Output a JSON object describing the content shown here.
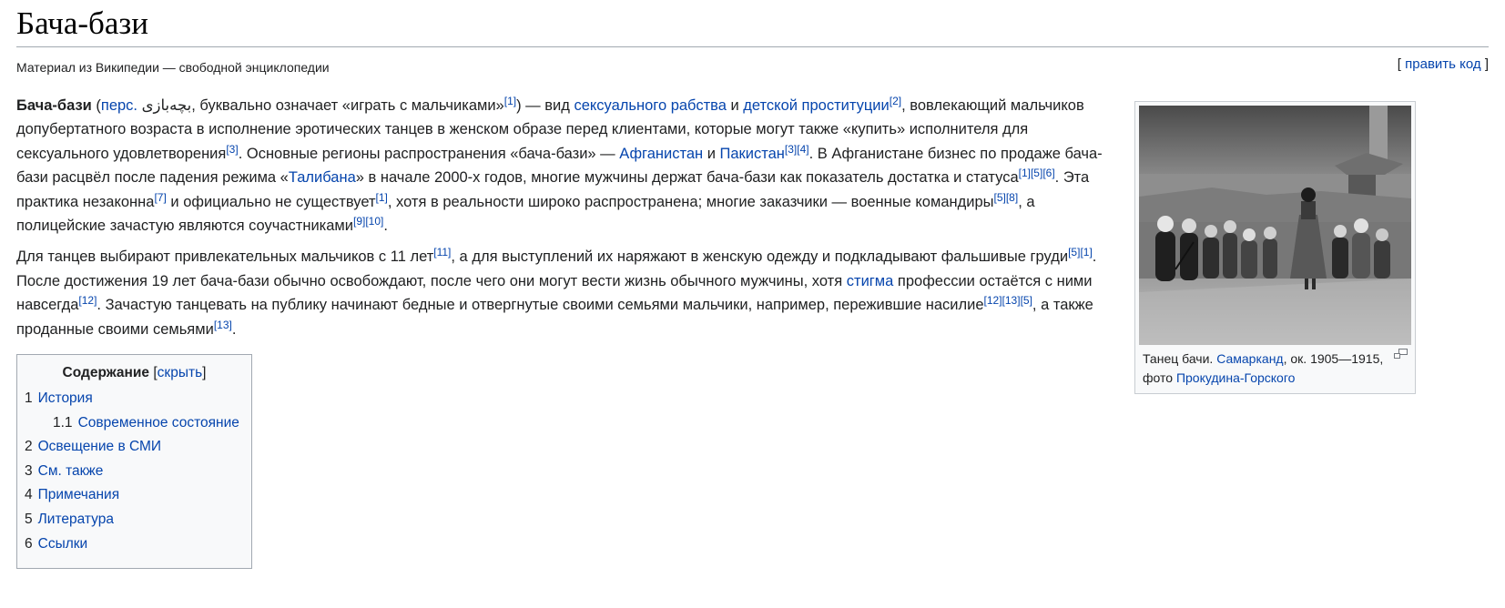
{
  "page": {
    "title": "Бача-бази",
    "tagline": "Материал из Википедии — свободной энциклопедии",
    "edit": {
      "open": "[ ",
      "label": "править код",
      "close": " ]"
    }
  },
  "paragraph1": {
    "term": "Бача-бази",
    "lang_link": "перс.",
    "persian": "بچه‌بازی",
    "t1": ", буквально означает «играть с мальчиками»",
    "r1": "[1]",
    "t2": " — вид ",
    "l1": "сексуального рабства",
    "t3": " и ",
    "l2": "детской проституции",
    "r2": "[2]",
    "t4": ", вовлекающий мальчиков допубертатного возраста в исполнение эротических танцев в женском образе перед клиентами, которые могут также «купить» исполнителя для сексуального удовлетворения",
    "r3": "[3]",
    "t5": ". Основные регионы распространения «бача-бази» — ",
    "l3": "Афганистан",
    "t6": " и ",
    "l4": "Пакистан",
    "r4": "[3]",
    "r5": "[4]",
    "t7": ". В Афганистане бизнес по продаже бача-бази расцвёл после падения режима «",
    "l5": "Талибана",
    "t8": "» в начале 2000-х годов, многие мужчины держат бача-бази как показатель достатка и статуса",
    "r6": "[1]",
    "r7": "[5]",
    "r8": "[6]",
    "t9": ". Эта практика незаконна",
    "r9": "[7]",
    "t10": " и официально не существует",
    "r10": "[1]",
    "t11": ", хотя в реальности широко распространена; многие заказчики — военные командиры",
    "r11": "[5]",
    "r12": "[8]",
    "t12": ", а полицейские зачастую являются соучастниками",
    "r13": "[9]",
    "r14": "[10]",
    "t13": "."
  },
  "paragraph2": {
    "t1": "Для танцев выбирают привлекательных мальчиков с 11 лет",
    "r1": "[11]",
    "t2": ", а для выступлений их наряжают в женскую одежду и подкладывают фальшивые груди",
    "r2": "[5]",
    "r3": "[1]",
    "t3": ". После достижения 19 лет бача-бази обычно освобождают, после чего они могут вести жизнь обычного мужчины, хотя ",
    "l1": "стигма",
    "t4": " профессии остаётся с ними навсегда",
    "r4": "[12]",
    "t5": ". Зачастую танцевать на публику начинают бедные и отвергнутые своими семьями мальчики, например, пережившие насилие",
    "r5": "[12]",
    "r6": "[13]",
    "r7": "[5]",
    "t6": ", а также проданные своими семьями",
    "r8": "[13]",
    "t7": "."
  },
  "toc": {
    "title": "Содержание",
    "toggle_open": "[",
    "toggle": "скрыть",
    "toggle_close": "]",
    "items": [
      {
        "num": "1",
        "label": "История"
      },
      {
        "num": "1.1",
        "label": "Современное состояние"
      },
      {
        "num": "2",
        "label": "Освещение в СМИ"
      },
      {
        "num": "3",
        "label": "См. также"
      },
      {
        "num": "4",
        "label": "Примечания"
      },
      {
        "num": "5",
        "label": "Литература"
      },
      {
        "num": "6",
        "label": "Ссылки"
      }
    ]
  },
  "figure": {
    "caption_t1": "Танец бачи. ",
    "caption_l1": "Самарканд",
    "caption_t2": ", ок. 1905—1915, фото ",
    "caption_l2": "Прокудина-Горского",
    "image_icon": "photo-image",
    "magnify_icon": "magnify-icon"
  },
  "colors": {
    "link": "#0645ad",
    "text": "#202122",
    "border": "#a2a9b1",
    "box_bg": "#f8f9fa"
  }
}
